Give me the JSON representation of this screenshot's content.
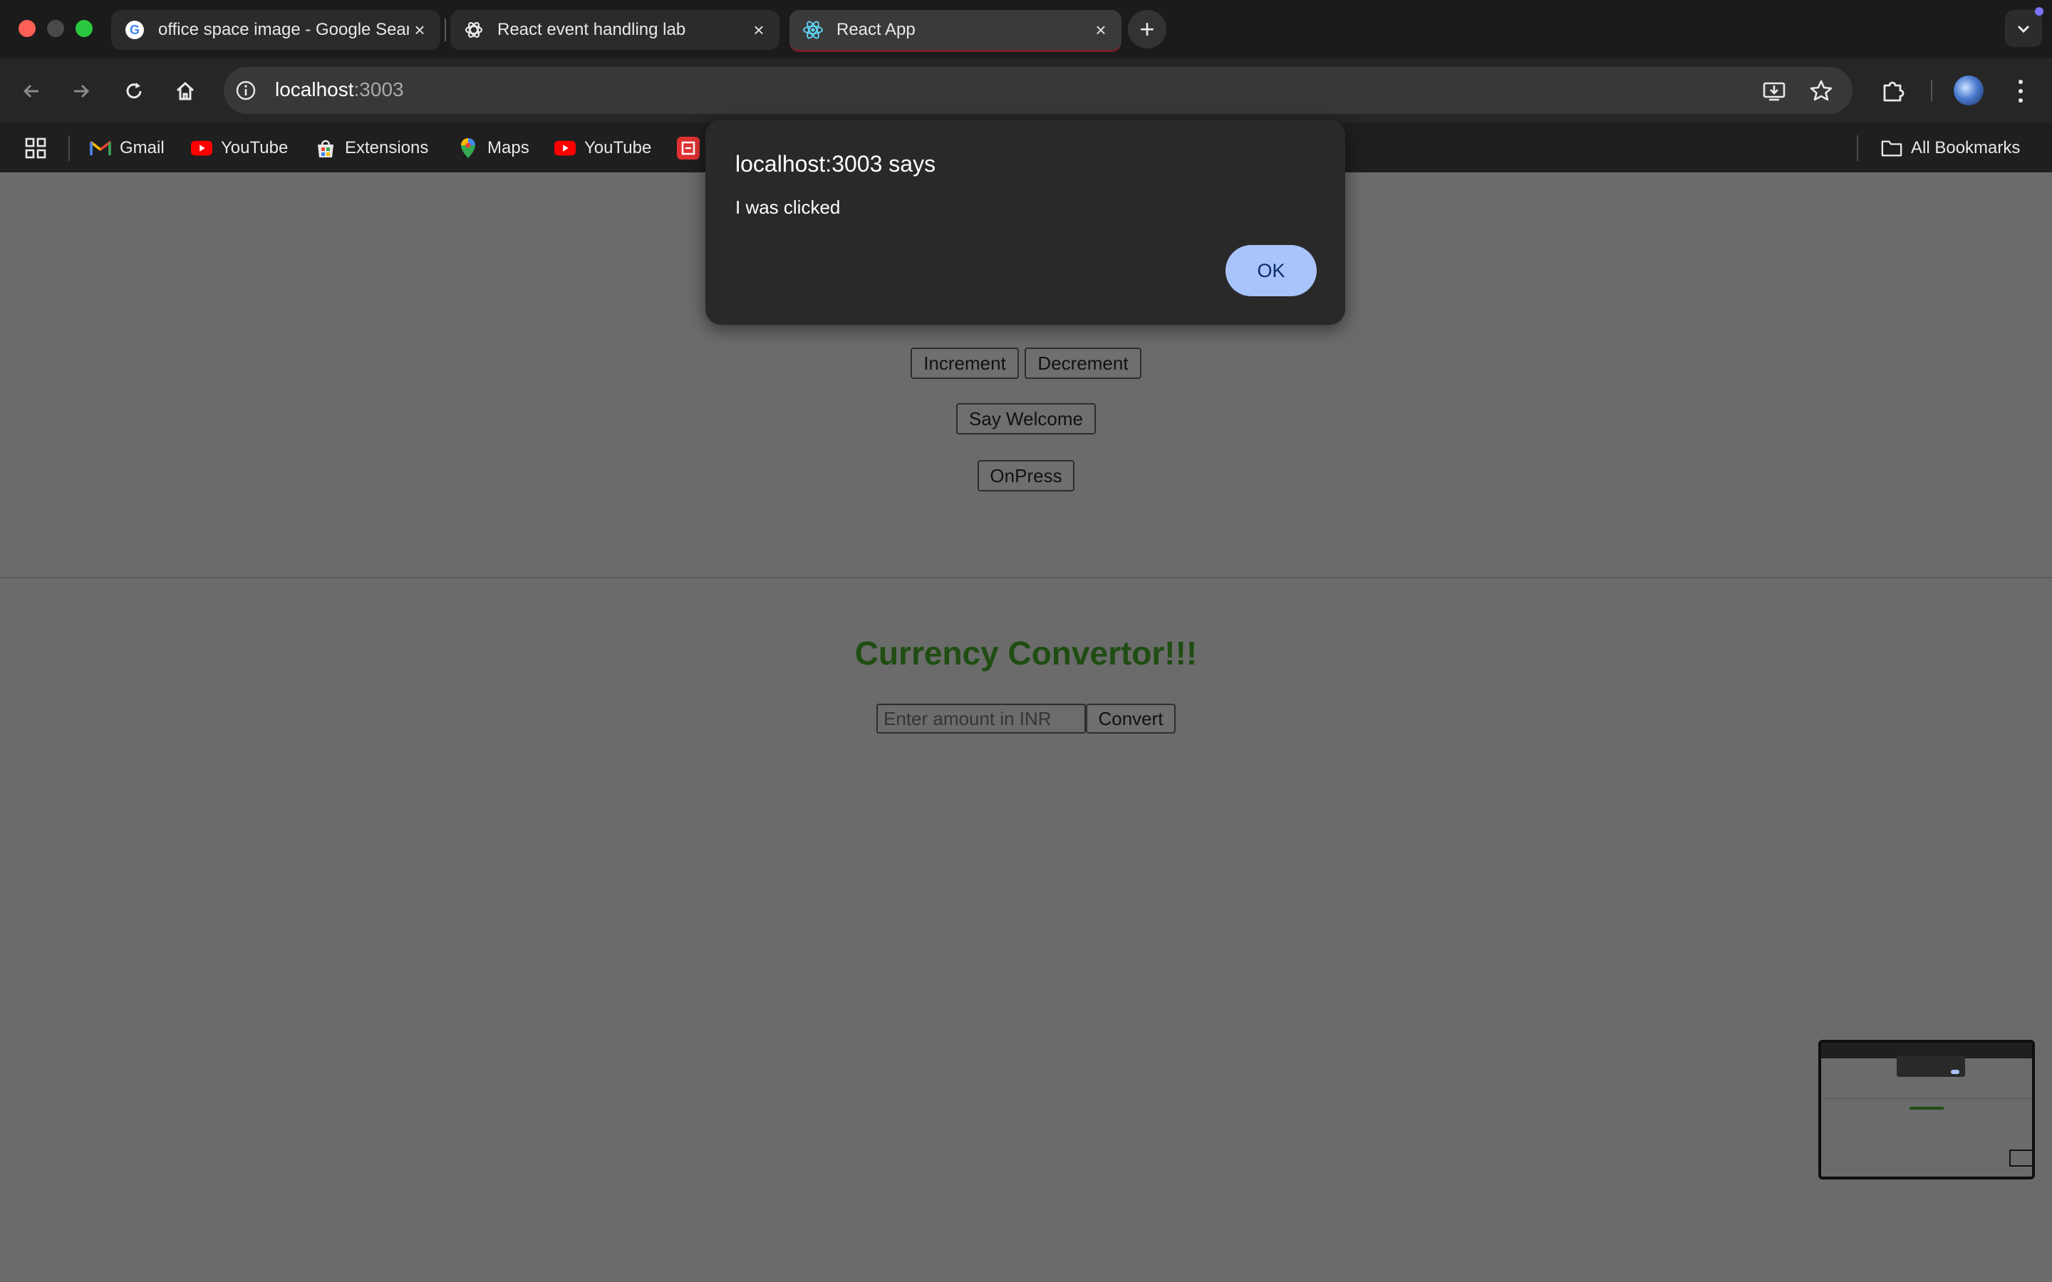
{
  "browser": {
    "tabs": [
      {
        "title": "office space image - Google Search",
        "favicon": "google-icon"
      },
      {
        "title": "React event handling lab",
        "favicon": "openai-icon"
      },
      {
        "title": "React App",
        "favicon": "react-icon"
      }
    ],
    "address": {
      "host": "localhost",
      "port": ":3003"
    },
    "bookmarks": [
      {
        "label": "Gmail",
        "icon": "gmail-icon"
      },
      {
        "label": "YouTube",
        "icon": "youtube-icon"
      },
      {
        "label": "Extensions",
        "icon": "chrome-web-store-icon"
      },
      {
        "label": "Maps",
        "icon": "maps-icon"
      },
      {
        "label": "YouTube",
        "icon": "youtube-icon"
      }
    ],
    "all_bookmarks": "All Bookmarks"
  },
  "dialog": {
    "title": "localhost:3003 says",
    "message": "I was clicked",
    "ok_label": "OK"
  },
  "app": {
    "increment_label": "Increment",
    "decrement_label": "Decrement",
    "say_welcome_label": "Say Welcome",
    "onpress_label": "OnPress",
    "currency": {
      "heading": "Currency Convertor!!!",
      "placeholder": "Enter amount in INR",
      "convert_label": "Convert"
    }
  },
  "colors": {
    "page_background": "#6b6b6b",
    "heading_color": "#1f4d12",
    "dialog_background": "#292929",
    "ok_button": "#a8c4fb"
  }
}
